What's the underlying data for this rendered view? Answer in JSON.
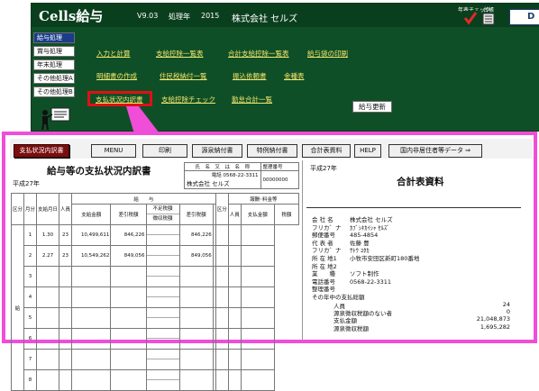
{
  "app": {
    "title": "Cells給与",
    "version": "V9.03",
    "year_label": "処理年",
    "year_value": "2015",
    "company": "株式会社 セルズ",
    "year_check_label": "年表チェック",
    "ledger_label": "台帳",
    "corner_icon_text": "D"
  },
  "sidebar": {
    "items": [
      {
        "label": "給与処理",
        "active": true
      },
      {
        "label": "賞与処理",
        "active": false
      },
      {
        "label": "年末処理",
        "active": false
      },
      {
        "label": "その他処理A",
        "active": false
      },
      {
        "label": "その他処理B",
        "active": false
      }
    ]
  },
  "menu": {
    "items": [
      "入力と計算",
      "支給控除一覧表",
      "合計支給控除一覧表",
      "給与袋の印刷",
      "明細書の作成",
      "住民税納付一覧",
      "振込依頼書",
      "金種表",
      "支払状況内訳書",
      "支給控除チェック",
      "勤怠合計一覧"
    ],
    "update_label": "給与更新"
  },
  "toolbar": {
    "buttons": [
      "支払状況内訳書",
      "MENU",
      "印刷",
      "源泉納付書",
      "特例納付書",
      "合計表資料",
      "HELP",
      "国内非居住者等データ ⇒"
    ]
  },
  "sheet": {
    "title": "給与等の支払状況内訳書",
    "year": "平成27年",
    "info_header": [
      "氏",
      "名",
      "又",
      "は",
      "名",
      "称",
      "整理番号"
    ],
    "phone_label": "電話",
    "phone": "0568-22-3311",
    "company": "株式会社 セルズ",
    "seiri_no": "00000000",
    "headers": {
      "kubun": "区分",
      "tsuki": "月分",
      "shikyu_date": "支給月日",
      "ninzu": "人員",
      "kyuyo": "給　　与",
      "shikyu_kingaku": "支給金額",
      "sashihiki": "差引税額",
      "fusoku": "不足税額",
      "choushu": "徴収税額",
      "sashihiki_zeigaku": "差引税額",
      "shotoku": "報酬･料金等",
      "kubun2": "区分",
      "ninzu2": "人員",
      "shikyu2": "支払金額",
      "zeigaku2": "税額"
    },
    "side_label": "給",
    "rows": [
      {
        "m": "1",
        "date": "1.30",
        "n": "23",
        "amount": "10,499,611",
        "tax": "846,226",
        "fusoku": "",
        "choushu": "",
        "net": "846,226"
      },
      {
        "m": "2",
        "date": "2.27",
        "n": "23",
        "amount": "10,549,262",
        "tax": "849,056",
        "fusoku": "",
        "choushu": "",
        "net": "849,056"
      },
      {
        "m": "3",
        "date": "",
        "n": "",
        "amount": "",
        "tax": "",
        "fusoku": "",
        "choushu": "",
        "net": ""
      },
      {
        "m": "4",
        "date": "",
        "n": "",
        "amount": "",
        "tax": "",
        "fusoku": "",
        "choushu": "",
        "net": ""
      },
      {
        "m": "5",
        "date": "",
        "n": "",
        "amount": "",
        "tax": "",
        "fusoku": "",
        "choushu": "",
        "net": ""
      },
      {
        "m": "6",
        "date": "",
        "n": "",
        "amount": "",
        "tax": "",
        "fusoku": "",
        "choushu": "",
        "net": ""
      },
      {
        "m": "7",
        "date": "",
        "n": "",
        "amount": "",
        "tax": "",
        "fusoku": "",
        "choushu": "",
        "net": ""
      },
      {
        "m": "8",
        "date": "",
        "n": "",
        "amount": "",
        "tax": "",
        "fusoku": "",
        "choushu": "",
        "net": ""
      }
    ]
  },
  "right": {
    "year": "平成27年",
    "title": "合計表資料",
    "fields": [
      {
        "k": "会 社 名",
        "v": "株式会社 セルズ"
      },
      {
        "k": "フリカ゛ナ",
        "v": "ｶﾌﾞｼｷｶｲｼｬ ｾﾙｽﾞ"
      },
      {
        "k": "郵便番号",
        "v": "485-4854"
      },
      {
        "k": "代 表 者",
        "v": "佐藤 豊"
      },
      {
        "k": "フリカ゛ナ",
        "v": "ｻﾄｳ ﾕﾀｶ"
      },
      {
        "k": "所 在 地1",
        "v": "小牧市安田区新町180番地"
      },
      {
        "k": "所 在 地2",
        "v": ""
      },
      {
        "k": "業　　種",
        "v": "ソフト制作"
      },
      {
        "k": "電話番号",
        "v": "0568-22-3311"
      },
      {
        "k": "整理番号",
        "v": ""
      }
    ],
    "pay_title": "その年中の支払総額",
    "pay_rows": [
      {
        "k": "人員",
        "v": "24"
      },
      {
        "k": "源泉徴収税額のない者",
        "v": "0"
      },
      {
        "k": "支払金額",
        "v": "21,048,873"
      },
      {
        "k": "源泉徴収税額",
        "v": "1,695,282"
      }
    ]
  },
  "colors": {
    "app_green": "#0f4f27",
    "menu_yellow": "#f4e76e",
    "highlight_red": "#e01010",
    "frame_pink": "#f04dd8",
    "active_btn": "#7a0e0e"
  }
}
